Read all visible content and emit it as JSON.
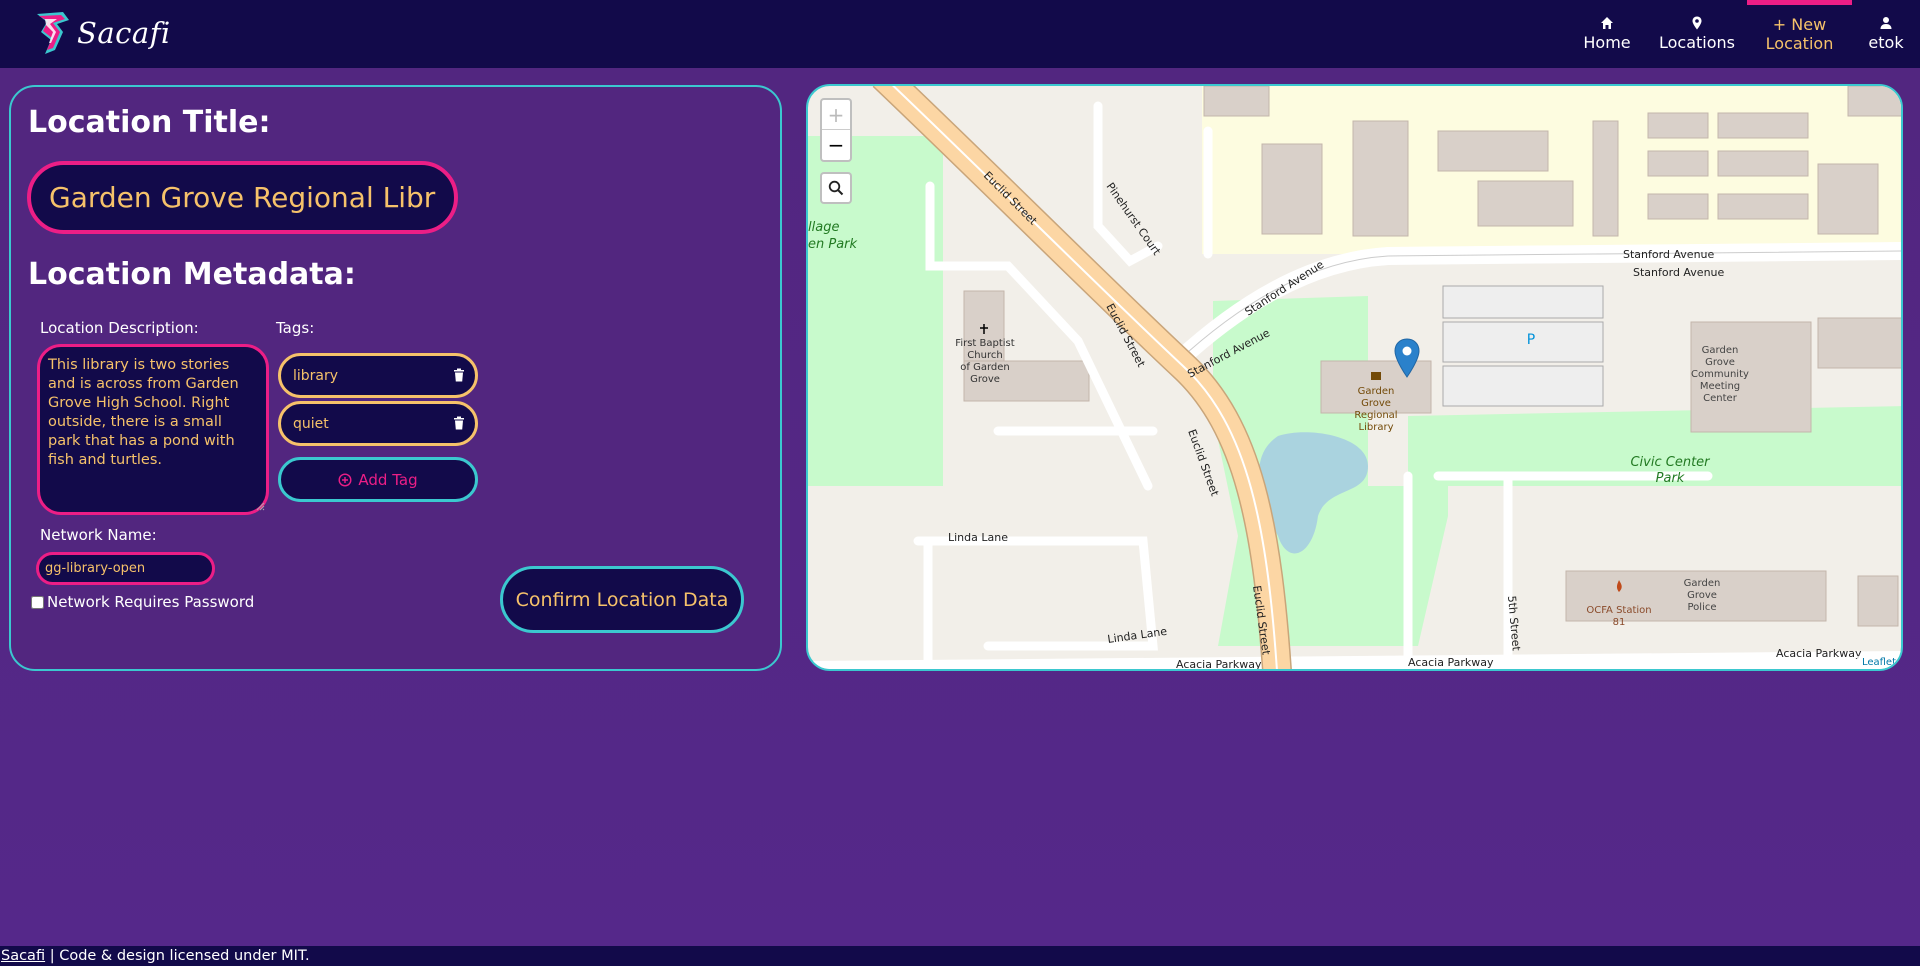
{
  "brand": {
    "name": "Sacafi",
    "logo_icon": "sacafi-logo-icon"
  },
  "nav": {
    "items": [
      {
        "label": "Home",
        "icon": "home-icon"
      },
      {
        "label": "Locations",
        "icon": "map-pin-icon"
      },
      {
        "label_line1": "+ New",
        "label_line2": "Location",
        "icon": "plus-icon",
        "active": true
      },
      {
        "label": "etok",
        "icon": "user-icon"
      }
    ]
  },
  "form": {
    "title_heading": "Location Title:",
    "title_value": "Garden Grove Regional Library",
    "metadata_heading": "Location Metadata:",
    "description_label": "Location Description:",
    "description_value": "This library is two stories and is across from Garden Grove High School. Right outside, there is a small park that has a pond with fish and turtles.",
    "tags_label": "Tags:",
    "tags": [
      "library",
      "quiet"
    ],
    "add_tag_label": "Add Tag",
    "network_label": "Network Name:",
    "network_value": "gg-library-open",
    "password_label": "Network Requires Password",
    "password_required": false,
    "confirm_label": "Confirm Location Data"
  },
  "map": {
    "zoom_in": "+",
    "zoom_out": "−",
    "streets": {
      "euclid": "Euclid Street",
      "stanford": "Stanford Avenue",
      "pinehurst": "Pinehurst Court",
      "linda": "Linda Lane",
      "acacia": "Acacia Parkway",
      "fifth": "5th Street"
    },
    "places": {
      "church": [
        "First Baptist",
        "Church",
        "of Garden",
        "Grove"
      ],
      "library": [
        "Garden",
        "Grove",
        "Regional",
        "Library"
      ],
      "meeting": [
        "Garden",
        "Grove",
        "Community",
        "Meeting",
        "Center"
      ],
      "police": [
        "Garden",
        "Grove",
        "Police"
      ],
      "fire": [
        "OCFA Station",
        "81"
      ],
      "civic_park": [
        "Civic Center",
        "Park"
      ],
      "village_park": [
        "llage",
        "en Park"
      ],
      "parking": "P"
    },
    "attribution": "Leaflet",
    "colors": {
      "road_major": "#fcd6a4",
      "park": "#c8facc",
      "building": "#d9d0c9",
      "water": "#aad3df",
      "residential": "#e0dfdf"
    }
  },
  "footer": {
    "link": "Sacafi",
    "separator": "|",
    "text": "Code & design licensed under MIT."
  }
}
